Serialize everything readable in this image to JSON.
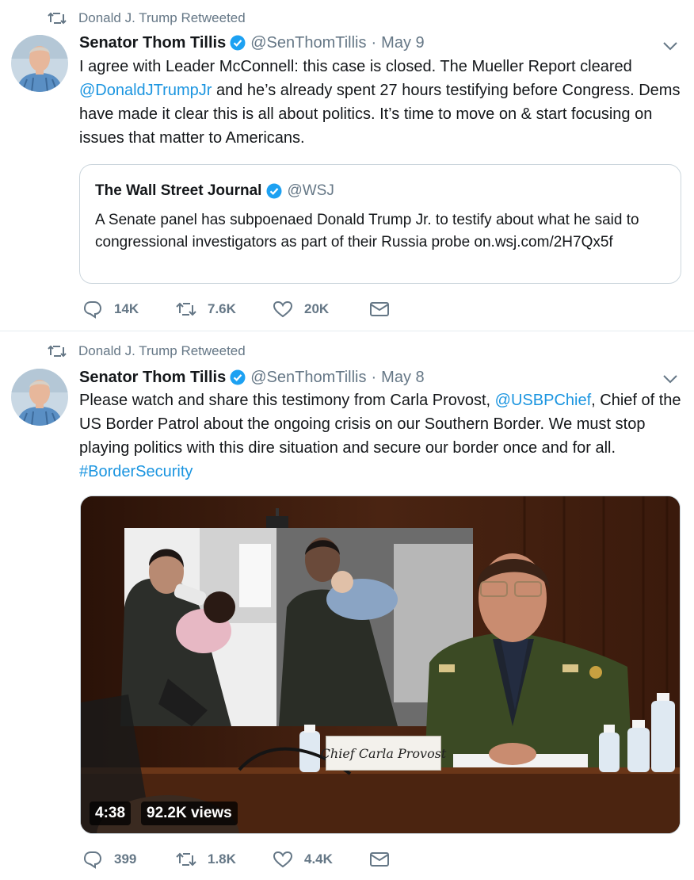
{
  "tweets": [
    {
      "retweeted_by": "Donald J. Trump Retweeted",
      "author_name": "Senator Thom Tillis",
      "author_handle": "@SenThomTillis",
      "separator": "·",
      "date": "May 9",
      "text": {
        "part1": "I agree with Leader McConnell: this case is closed. The Mueller Report cleared ",
        "mention": "@DonaldJTrumpJr",
        "part2": " and he’s already spent 27 hours testifying before Congress. Dems have made it clear this is all about politics. It’s time to move on & start focusing on issues that matter to Americans."
      },
      "quote": {
        "name": "The Wall Street Journal",
        "handle": "@WSJ",
        "text": "A Senate panel has subpoenaed Donald Trump Jr. to testify about what he said to congressional investigators as part of their Russia probe on.wsj.com/2H7Qx5f"
      },
      "replies": "14K",
      "retweets": "7.6K",
      "likes": "20K"
    },
    {
      "retweeted_by": "Donald J. Trump Retweeted",
      "author_name": "Senator Thom Tillis",
      "author_handle": "@SenThomTillis",
      "separator": "·",
      "date": "May 8",
      "text": {
        "part1": "Please watch and share this testimony from Carla Provost, ",
        "mention": "@USBPChief",
        "part2": ", Chief of the US Border Patrol about the ongoing crisis on our Southern Border. We must stop playing politics with this dire situation and secure our border once and for all. ",
        "hashtag": "#BorderSecurity"
      },
      "video": {
        "duration": "4:38",
        "views": "92.2K views",
        "nameplate": "Chief Carla Provost"
      },
      "replies": "399",
      "retweets": "1.8K",
      "likes": "4.4K"
    }
  ],
  "icons": [
    "retweet-icon",
    "verified-badge-icon",
    "chevron-down-icon",
    "reply-icon",
    "like-icon",
    "direct-message-icon"
  ],
  "colors": {
    "link": "#1b95e0",
    "secondary_text": "#657786",
    "verified": "#1da1f2",
    "border": "#e6ecf0"
  }
}
